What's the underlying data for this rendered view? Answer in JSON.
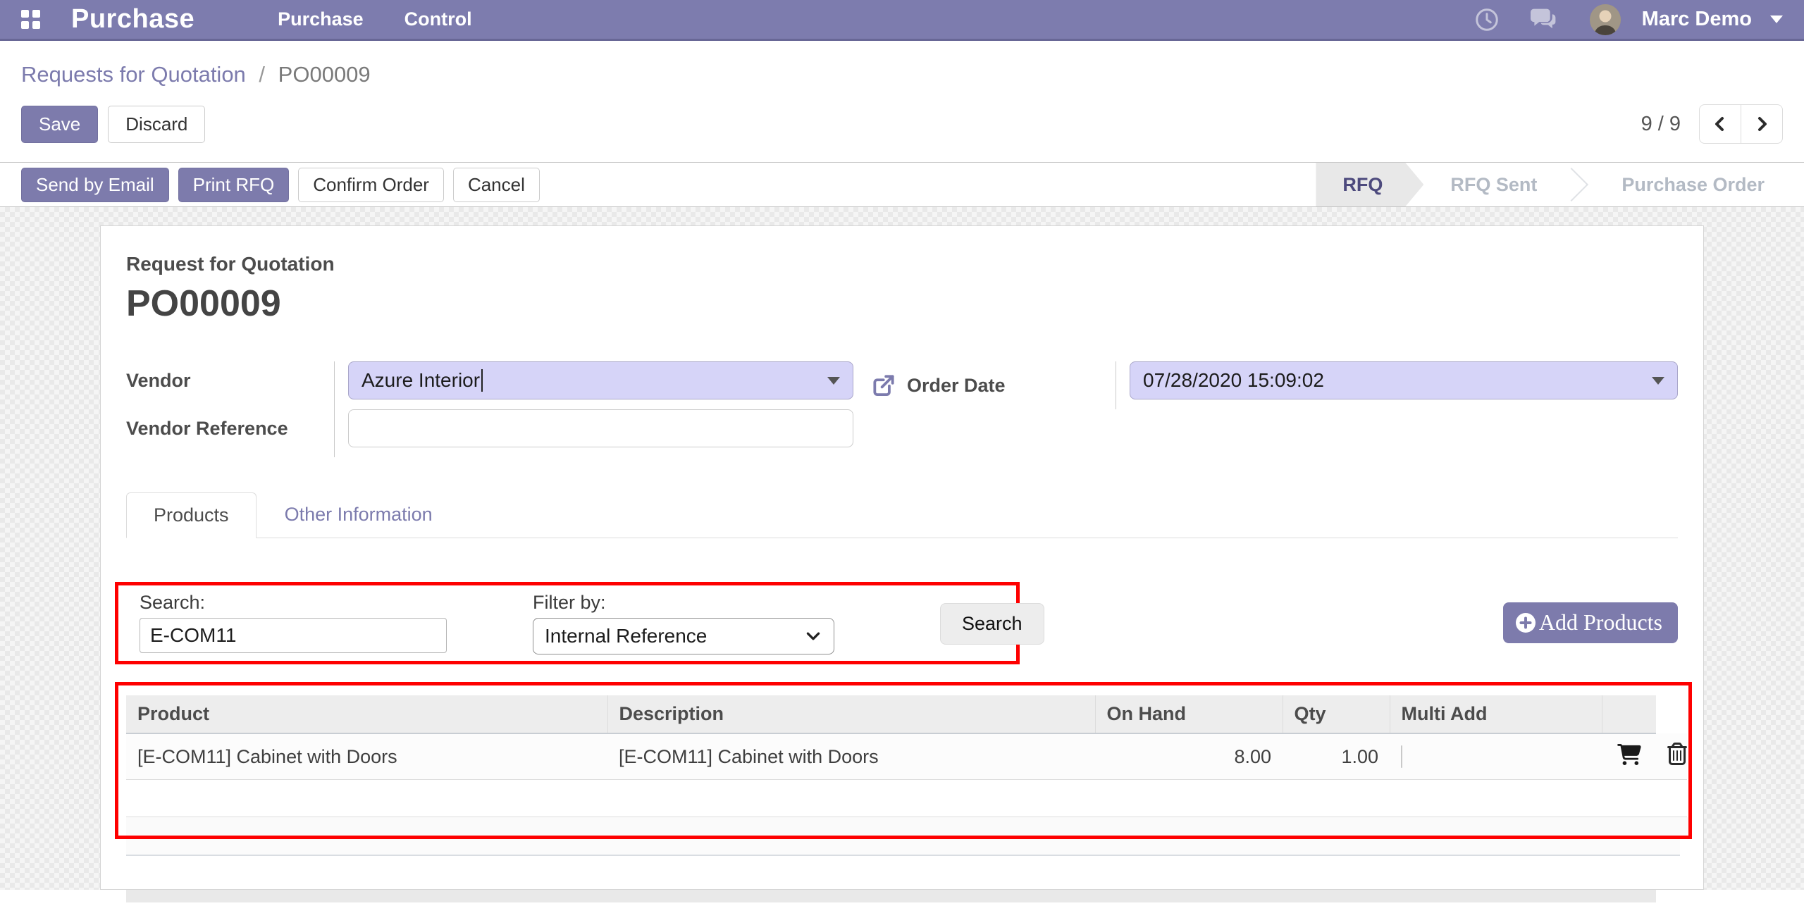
{
  "colors": {
    "primary": "#7d7bac",
    "navbar": "#7d7cae",
    "field_highlight": "#d6d4f8",
    "annotation_red": "#fe0000",
    "link": "#7c7bad",
    "state_active_text": "#4d4a7d"
  },
  "navbar": {
    "brand": "Purchase",
    "menu_purchase": "Purchase",
    "menu_control": "Control",
    "user_name": "Marc Demo"
  },
  "breadcrumb": {
    "parent": "Requests for Quotation",
    "separator": "/",
    "current": "PO00009"
  },
  "control_panel": {
    "save": "Save",
    "discard": "Discard",
    "pager": "9 / 9"
  },
  "statusbar": {
    "send_by_email": "Send by Email",
    "print_rfq": "Print RFQ",
    "confirm_order": "Confirm Order",
    "cancel": "Cancel",
    "states": [
      {
        "label": "RFQ",
        "active": true
      },
      {
        "label": "RFQ Sent",
        "active": false
      },
      {
        "label": "Purchase Order",
        "active": false
      }
    ]
  },
  "form": {
    "sheet_title": "Request for Quotation",
    "record_name": "PO00009",
    "vendor_label": "Vendor",
    "vendor_value": "Azure Interior",
    "vendor_reference_label": "Vendor Reference",
    "vendor_reference_value": "",
    "order_date_label": "Order Date",
    "order_date_value": "07/28/2020 15:09:02",
    "tabs": {
      "products": "Products",
      "other_information": "Other Information"
    },
    "search_panel": {
      "search_label": "Search:",
      "search_value": "E-COM11",
      "filter_label": "Filter by:",
      "filter_value": "Internal Reference",
      "search_button": "Search",
      "add_products_button": "Add Products"
    },
    "products_table": {
      "headers": {
        "product": "Product",
        "description": "Description",
        "on_hand": "On Hand",
        "qty": "Qty",
        "multi_add": "Multi Add"
      },
      "row": {
        "product": "[E-COM11] Cabinet with Doors",
        "description": "[E-COM11] Cabinet with Doors",
        "on_hand": "8.00",
        "qty": "1.00",
        "multi_add_checked": false
      }
    }
  }
}
